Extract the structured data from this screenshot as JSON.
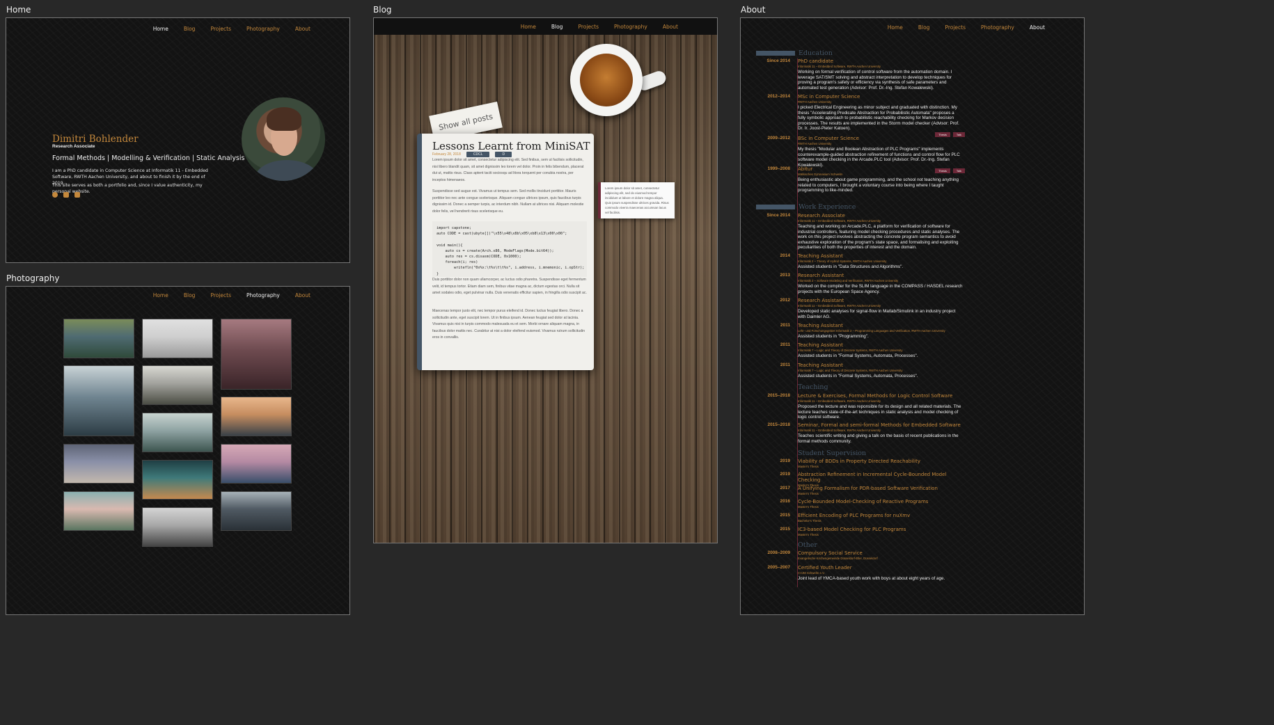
{
  "panels": {
    "home": "Home",
    "blog": "Blog",
    "about": "About",
    "photography": "Photography"
  },
  "nav": [
    "Home",
    "Blog",
    "Projects",
    "Photography",
    "About"
  ],
  "home": {
    "name": "Dimitri Bohlender",
    "role": "Research Associate",
    "fields": "Formal Methods | Modelling & Verification | Static Analysis",
    "bio1": "I am a PhD candidate in Computer Science at Informatik 11 - Embedded Software, RWTH Aachen University, and about to finish it by the end of 2019.",
    "bio2": "This site serves as both a portfolio and, since I value authenticity, my personal website.",
    "icons": [
      "github-icon",
      "facebook-icon",
      "mail-icon"
    ]
  },
  "blog": {
    "show_all": "Show all posts",
    "title": "Lessons Learnt from MiniSAT",
    "date": "February 28, 2018",
    "tags": [
      "CDCL",
      "D"
    ],
    "p1": "Lorem ipsum dolor sit amet, consectetur adipiscing elit. Sed finibus, sem ut facilisis sollicitudin, nisi libero blandit quam, sit amet dignissim leo lorem vel dolor. Proin in felis bibendum, placerat dui ut, mattis risus. Class aptent taciti sociosqu ad litora torquent per conubia nostra, per inceptos himenaeos.",
    "p2": "Suspendisse sed augue est. Vivamus ut tempus sem. Sed mollis tincidunt porttitor. Mauris porttitor leo nec ante congue scelerisque. Aliquam congue ultrices ipsum, quis faucibus turpis dignissim id. Donec a semper turpis, ac interdum nibh. Nullam at ultrices nisi. Aliquam molestie dolor felis, vel hendrerit risus scelerisque eu.",
    "code": "import capstone;\nauto CODE = cast(ubyte[])\"\\x55\\x48\\x8b\\x05\\xb8\\x13\\x00\\x00\";\n\nvoid main(){\n    auto cs = create(Arch.x86, ModeFlags(Mode.bit64));\n    auto res = cs.disasm(CODE, 0x1000);\n    foreach(i; res)\n        writefln(\"0x%x:\\t%s\\t\\t%s\", i.address, i.mnemonic, i.opStr);\n}",
    "p3": "Duis porttitor dolor non quam ullamcorper, ac luctus odio pharetra. Suspendisse eget fermentum velit, id tempus tortor. Etiam diam sem, finibus vitae magna ac, dictum egestas orci. Nulla sit amet sodales odio, eget pulvinar nulla. Duis venenatis efficitur sapien, in fringilla odio suscipit ac.",
    "p4": "Maecenas tempor justo elit, nec tempor purus eleifend id. Donec luctus feugiat libero. Donec a sollicitudin ante, eget suscipit lorem. Ut in finibus ipsum. Aenean feugiat sed dolor at lacinia. Vivamus quis nisi in turpis commodo malesuada eu et sem. Morbi ornare aliquam magna, in faucibus dolor mattis nec. Curabitur at nisi a dolor eleifend euismod. Vivamus rutrum sollicitudin eros in convallis.",
    "aside": "Lorem ipsum dolor sit amet, consectetur adipiscing elit, sed do eiusmod tempor incididunt ut labore et dolore magna aliqua. Quis ipsum suspendisse ultrices gravida. Risus commodo viverra maecenas accumsan lacus vel facilisis."
  },
  "about": {
    "sections": {
      "education": "Education",
      "work": "Work Experience",
      "teaching": "Teaching",
      "supervision": "Student Supervision",
      "other": "Other"
    },
    "education": [
      {
        "date": "Since 2014",
        "title": "PhD candidate",
        "inst": "Informatik 11 – Embedded Software, RWTH Aachen University",
        "desc": "Working on formal verification of control software from the automation domain. I leverage SAT/SMT solving and abstract interpretation to develop techniques for proving a program's safety or efficiency via synthesis of safe parameters and automated test generation (Advisor: Prof. Dr.-Ing. Stefan Kowalewski).",
        "tags": []
      },
      {
        "date": "2012–2014",
        "title": "MSc in Computer Science",
        "inst": "RWTH Aachen University",
        "desc": "I picked Electrical Engineering as minor subject and graduated with distinction. My thesis \"Accelerating Predicate Abstraction for Probabilistic Automata\" proposes a fully symbolic approach to probabilistic reachability checking for Markov decision processes. The results are implemented in the Storm model checker (Advisor: Prof. Dr. Ir. Joost-Pieter Katoen).",
        "tags": [
          "Thesis",
          "Talk"
        ]
      },
      {
        "date": "2009–2012",
        "title": "BSc in Computer Science",
        "inst": "RWTH Aachen University",
        "desc": "My thesis \"Modular and Boolean Abstraction of PLC Programs\" implements counterexample-guided abstraction refinement of functions and control flow for PLC software model checking in the Arcade.PLC tool (Advisor: Prof. Dr.-Ing. Stefan Kowalewski).",
        "tags": [
          "Thesis",
          "Talk"
        ]
      },
      {
        "date": "1999–2008",
        "title": "Abitur",
        "inst": "Märkisches Gymnasium Schwelm",
        "desc": "Being enthusiastic about game programming, and the school not teaching anything related to computers, I brought a voluntary course into being where I taught programming to like-minded.",
        "tags": []
      }
    ],
    "work": [
      {
        "date": "Since 2014",
        "title": "Research Associate",
        "inst": "Informatik 11 – Embedded Software, RWTH Aachen University",
        "desc": "Teaching and working on Arcade.PLC, a platform for verification of software for industrial controllers, featuring model checking procedures and static analyses. The work on this project involves abstracting the concrete program semantics to avoid exhaustive exploration of the program's state space, and formalising and exploiting peculiarities of both the properties of interest and the domain."
      },
      {
        "date": "2014",
        "title": "Teaching Assistant",
        "inst": "Informatik 2 – Theory of Hybrid Systems, RWTH Aachen University",
        "desc": "Assisted students in \"Data Structures and Algorithms\"."
      },
      {
        "date": "2013",
        "title": "Research Assistant",
        "inst": "Informatik 2 – Software Modeling and Verification, RWTH Aachen University",
        "desc": "Worked on the compiler for the SLIM language in the COMPASS / HASDEL research projects with the European Space Agency."
      },
      {
        "date": "2012",
        "title": "Research Assistant",
        "inst": "Informatik 11 – Embedded Software, RWTH Aachen University",
        "desc": "Developed static analyses for signal-flow in Matlab/Simulink in an industry project with Daimler AG."
      },
      {
        "date": "2011",
        "title": "Teaching Assistant",
        "inst": "Lehr- und Forschungsgebiet Informatik 2 – Programming Languages and Verification, RWTH Aachen University",
        "desc": "Assisted students in \"Programming\"."
      },
      {
        "date": "2011",
        "title": "Teaching Assistant",
        "inst": "Informatik 7 – Logic and Theory of Discrete Systems, RWTH Aachen University",
        "desc": "Assisted students in \"Formal Systems, Automata, Processes\"."
      },
      {
        "date": "2011",
        "title": "Teaching Assistant",
        "inst": "Informatik 7 – Logic and Theory of Discrete Systems, RWTH Aachen University",
        "desc": "Assisted students in \"Formal Systems, Automata, Processes\"."
      }
    ],
    "teaching": [
      {
        "date": "2015–2018",
        "title": "Lecture & Exercises, Formal Methods for Logic Control Software",
        "inst": "Informatik 11 – Embedded Software, RWTH Aachen University",
        "desc": "Proposed the lecture and was reponsible for its design and all related materials. The lecture teaches state-of-the-art techniques in static analysis and model checking of logic control software."
      },
      {
        "date": "2015–2018",
        "title": "Seminar, Formal and semi-formal Methods for Embedded Software",
        "inst": "Informatik 11 – Embedded Software, RWTH Aachen University",
        "desc": "Teaches scientific writing and giving a talk on the basis of recent publications in the formal methods community."
      }
    ],
    "supervision": [
      {
        "date": "2019",
        "title": "Viability of BDDs in Property Directed Reachability",
        "inst": "Master's Thesis"
      },
      {
        "date": "2019",
        "title": "Abstraction Refinement in Incremental Cycle-Bounded Model Checking",
        "inst": "Master's Thesis"
      },
      {
        "date": "2017",
        "title": "A Unifying Formalism for PDR-based Software Verification",
        "inst": "Master's Thesis"
      },
      {
        "date": "2016",
        "title": "Cycle-Bounded Model-Checking of Reactive Programs",
        "inst": "Master's Thesis"
      },
      {
        "date": "2015",
        "title": "Efficient Encoding of PLC Programs for nuXmv",
        "inst": "Bachelor's Thesis"
      },
      {
        "date": "2015",
        "title": "IC3-based Model Checking for PLC Programs",
        "inst": "Master's Thesis"
      }
    ],
    "other": [
      {
        "date": "2008–2009",
        "title": "Compulsory Social Service",
        "inst": "Evangelische Kirchengemeinde Düsseldorf-Eller, Düsseldorf",
        "desc": ""
      },
      {
        "date": "2005–2007",
        "title": "Certified Youth Leader",
        "inst": "CVJM Schwelm e.V.",
        "desc": "Joint lead of YMCA-based youth work with boys at about eight years of age."
      }
    ]
  },
  "photos": [
    {
      "name": "photo-forest-clouds",
      "colors": [
        "#4f6b72",
        "#2f4a3a",
        "#7a8c59"
      ]
    },
    {
      "name": "photo-power-pylon",
      "colors": [
        "#cfcfcf",
        "#9a9a9a",
        "#e0e0e0"
      ]
    },
    {
      "name": "photo-red-stairs",
      "colors": [
        "#6d4a4f",
        "#3a2428",
        "#a67a80"
      ]
    },
    {
      "name": "photo-stormy-coast",
      "colors": [
        "#6f8490",
        "#2c3c44",
        "#c9d3d6"
      ]
    },
    {
      "name": "photo-snow-mountain",
      "colors": [
        "#a3a39e",
        "#4b4d44",
        "#d8d8d2"
      ]
    },
    {
      "name": "photo-misty-hills",
      "colors": [
        "#8fa3a3",
        "#3d5550",
        "#c8d4d0"
      ]
    },
    {
      "name": "photo-sunset-cliff",
      "colors": [
        "#c68d60",
        "#3a4148",
        "#e8b78c"
      ]
    },
    {
      "name": "photo-concrete-sculpture",
      "colors": [
        "#8a90a8",
        "#c3b8ad",
        "#5e6476"
      ]
    },
    {
      "name": "photo-pink-sea-sunset",
      "colors": [
        "#b58aa3",
        "#394e6a",
        "#d6a9b6"
      ]
    },
    {
      "name": "photo-lighthouse",
      "colors": [
        "#d9b9b0",
        "#5a7560",
        "#8ab0b0"
      ]
    },
    {
      "name": "photo-rocky-shore-aerial",
      "colors": [
        "#3f7a7a",
        "#c4894f",
        "#1f3f44"
      ]
    },
    {
      "name": "photo-dark-clouds-sea",
      "colors": [
        "#505a63",
        "#2a3137",
        "#a7b2b8"
      ]
    },
    {
      "name": "photo-bw-tree",
      "colors": [
        "#a8a8a8",
        "#444444",
        "#d4d4d4"
      ]
    }
  ]
}
